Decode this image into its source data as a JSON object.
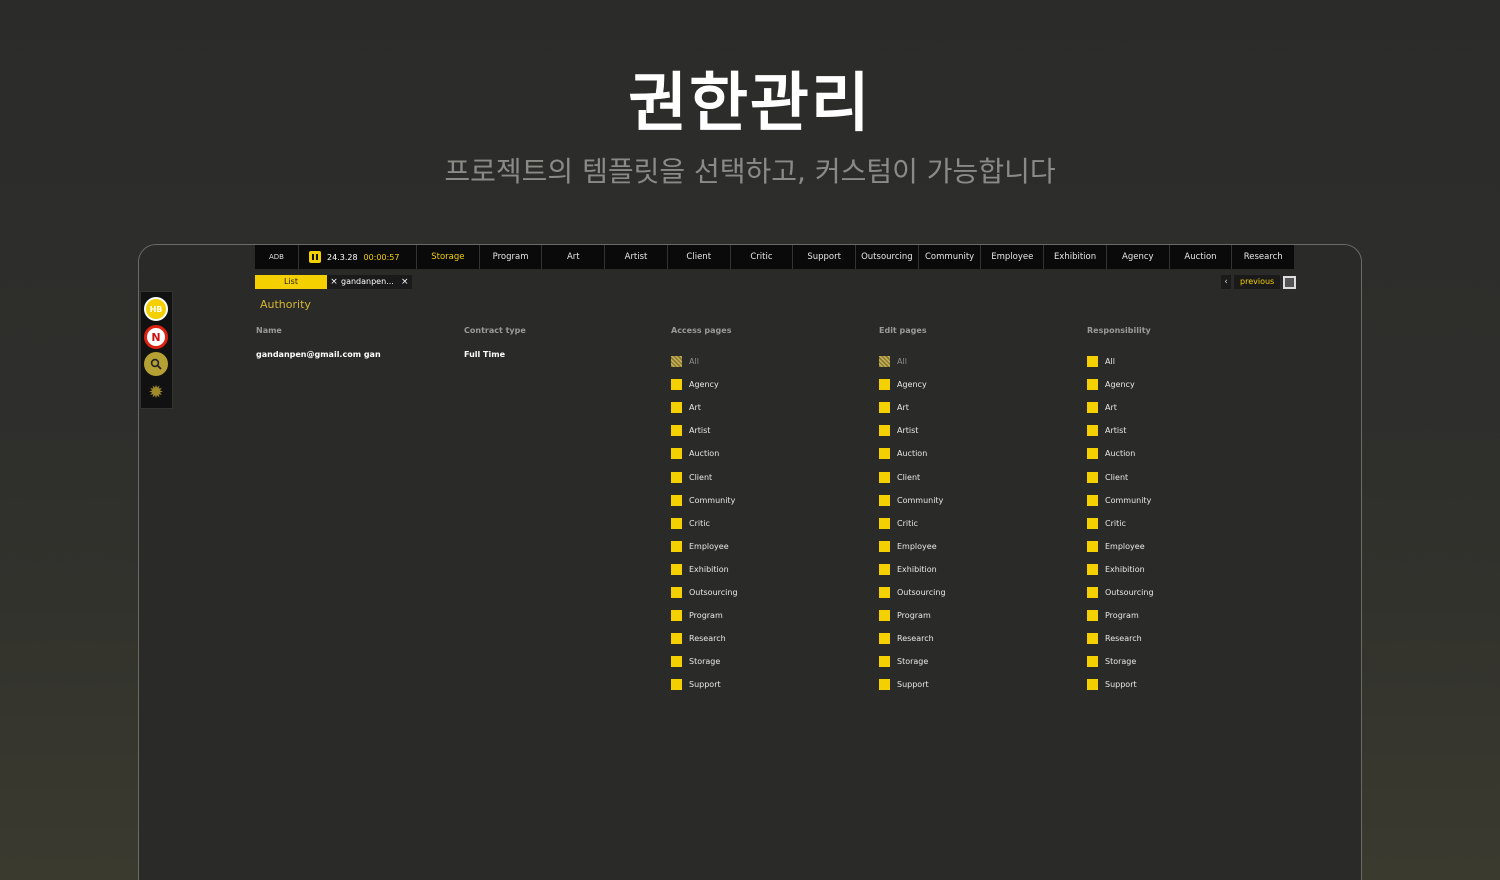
{
  "hero": {
    "title": "권한관리",
    "subtitle": "프로젝트의 템플릿을 선택하고, 커스텀이 가능합니다"
  },
  "sidebar": {
    "items": [
      {
        "label": "HB",
        "icon": "hb-badge-icon"
      },
      {
        "label": "N",
        "icon": "notification-icon"
      },
      {
        "label": "",
        "icon": "search-icon"
      },
      {
        "label": "",
        "icon": "gear-icon"
      }
    ]
  },
  "topnav": {
    "logo": "ADB",
    "date": "24.3.28",
    "time": "00:00:57",
    "items": [
      "Storage",
      "Program",
      "Art",
      "Artist",
      "Client",
      "Critic",
      "Support",
      "Outsourcing",
      "Community",
      "Employee",
      "Exhibition",
      "Agency",
      "Auction",
      "Research"
    ],
    "active": "Storage"
  },
  "tabs": {
    "list_label": "List",
    "close": "×",
    "user_tab": "gandanpen...",
    "user_close": "×"
  },
  "pager": {
    "chevron": "‹",
    "previous": "previous"
  },
  "page": {
    "section_title": "Authority"
  },
  "columns": {
    "name": {
      "header": "Name",
      "value": "gandanpen@gmail.com gan"
    },
    "contract": {
      "header": "Contract type",
      "value": "Full Time"
    },
    "access": {
      "header": "Access pages"
    },
    "edit": {
      "header": "Edit pages"
    },
    "responsibility": {
      "header": "Responsibility"
    }
  },
  "permissions": {
    "all_label": "All",
    "pages": [
      "Agency",
      "Art",
      "Artist",
      "Auction",
      "Client",
      "Community",
      "Critic",
      "Employee",
      "Exhibition",
      "Outsourcing",
      "Program",
      "Research",
      "Storage",
      "Support"
    ],
    "access_all_state": "partial",
    "edit_all_state": "partial",
    "responsibility_all_state": "checked"
  },
  "colors": {
    "accent": "#f5d000",
    "background": "#2a2a29",
    "nav": "#0a0a0a"
  }
}
